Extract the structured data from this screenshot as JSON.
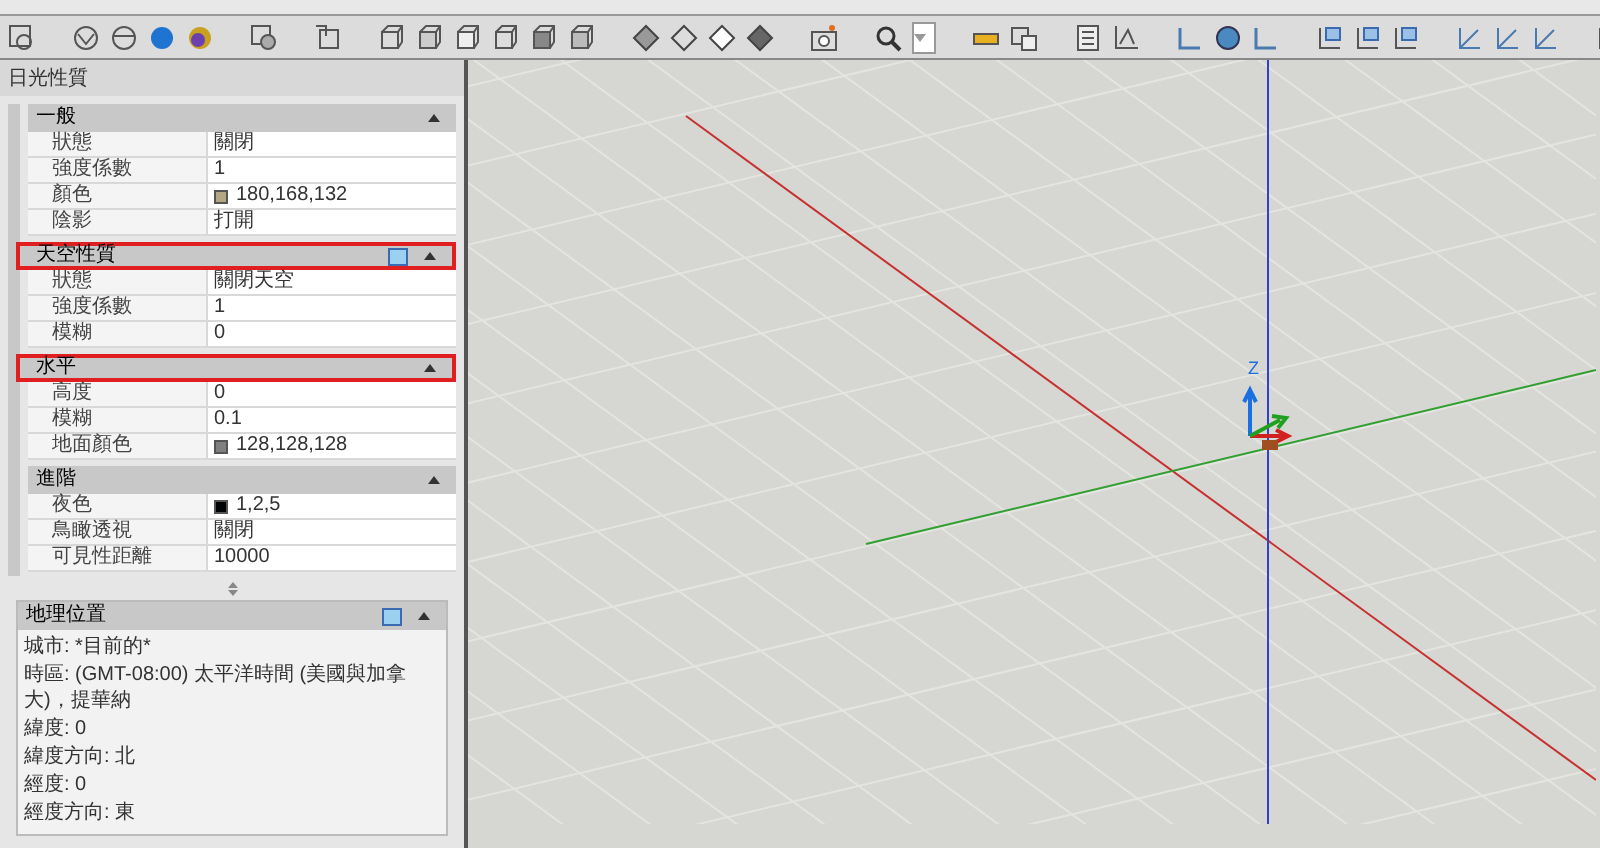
{
  "palette": {
    "title": "日光性質",
    "sections": [
      {
        "title": "一般",
        "highlighted": false,
        "has_preview": false,
        "rows": [
          {
            "kind": "text",
            "label": "狀態",
            "value": "關閉"
          },
          {
            "kind": "text",
            "label": "強度係數",
            "value": "1"
          },
          {
            "kind": "color",
            "label": "顏色",
            "value": "180,168,132",
            "color": "#b4a884"
          },
          {
            "kind": "text",
            "label": "陰影",
            "value": "打開"
          }
        ]
      },
      {
        "title": "天空性質",
        "highlighted": true,
        "has_preview": true,
        "rows": [
          {
            "kind": "text",
            "label": "狀態",
            "value": "關閉天空"
          },
          {
            "kind": "text",
            "label": "強度係數",
            "value": "1"
          },
          {
            "kind": "text",
            "label": "模糊",
            "value": "0"
          }
        ]
      },
      {
        "title": "水平",
        "highlighted": true,
        "has_preview": false,
        "rows": [
          {
            "kind": "text",
            "label": "高度",
            "value": "0"
          },
          {
            "kind": "text",
            "label": "模糊",
            "value": "0.1"
          },
          {
            "kind": "color",
            "label": "地面顏色",
            "value": "128,128,128",
            "color": "#808080"
          }
        ]
      },
      {
        "title": "進階",
        "highlighted": false,
        "has_preview": false,
        "rows": [
          {
            "kind": "color",
            "label": "夜色",
            "value": "1,2,5",
            "color": "#010205"
          },
          {
            "kind": "text",
            "label": "鳥瞰透視",
            "value": "關閉"
          },
          {
            "kind": "text",
            "label": "可見性距離",
            "value": "10000"
          }
        ]
      }
    ]
  },
  "geo": {
    "title": "地理位置",
    "lines": [
      "城市: *目前的*",
      "時區: (GMT-08:00) 太平洋時間 (美國與加拿大)，提華納",
      "緯度: 0",
      "緯度方向: 北",
      "經度: 0",
      "經度方向: 東"
    ]
  },
  "viewport": {
    "ucs_label": "Z"
  }
}
